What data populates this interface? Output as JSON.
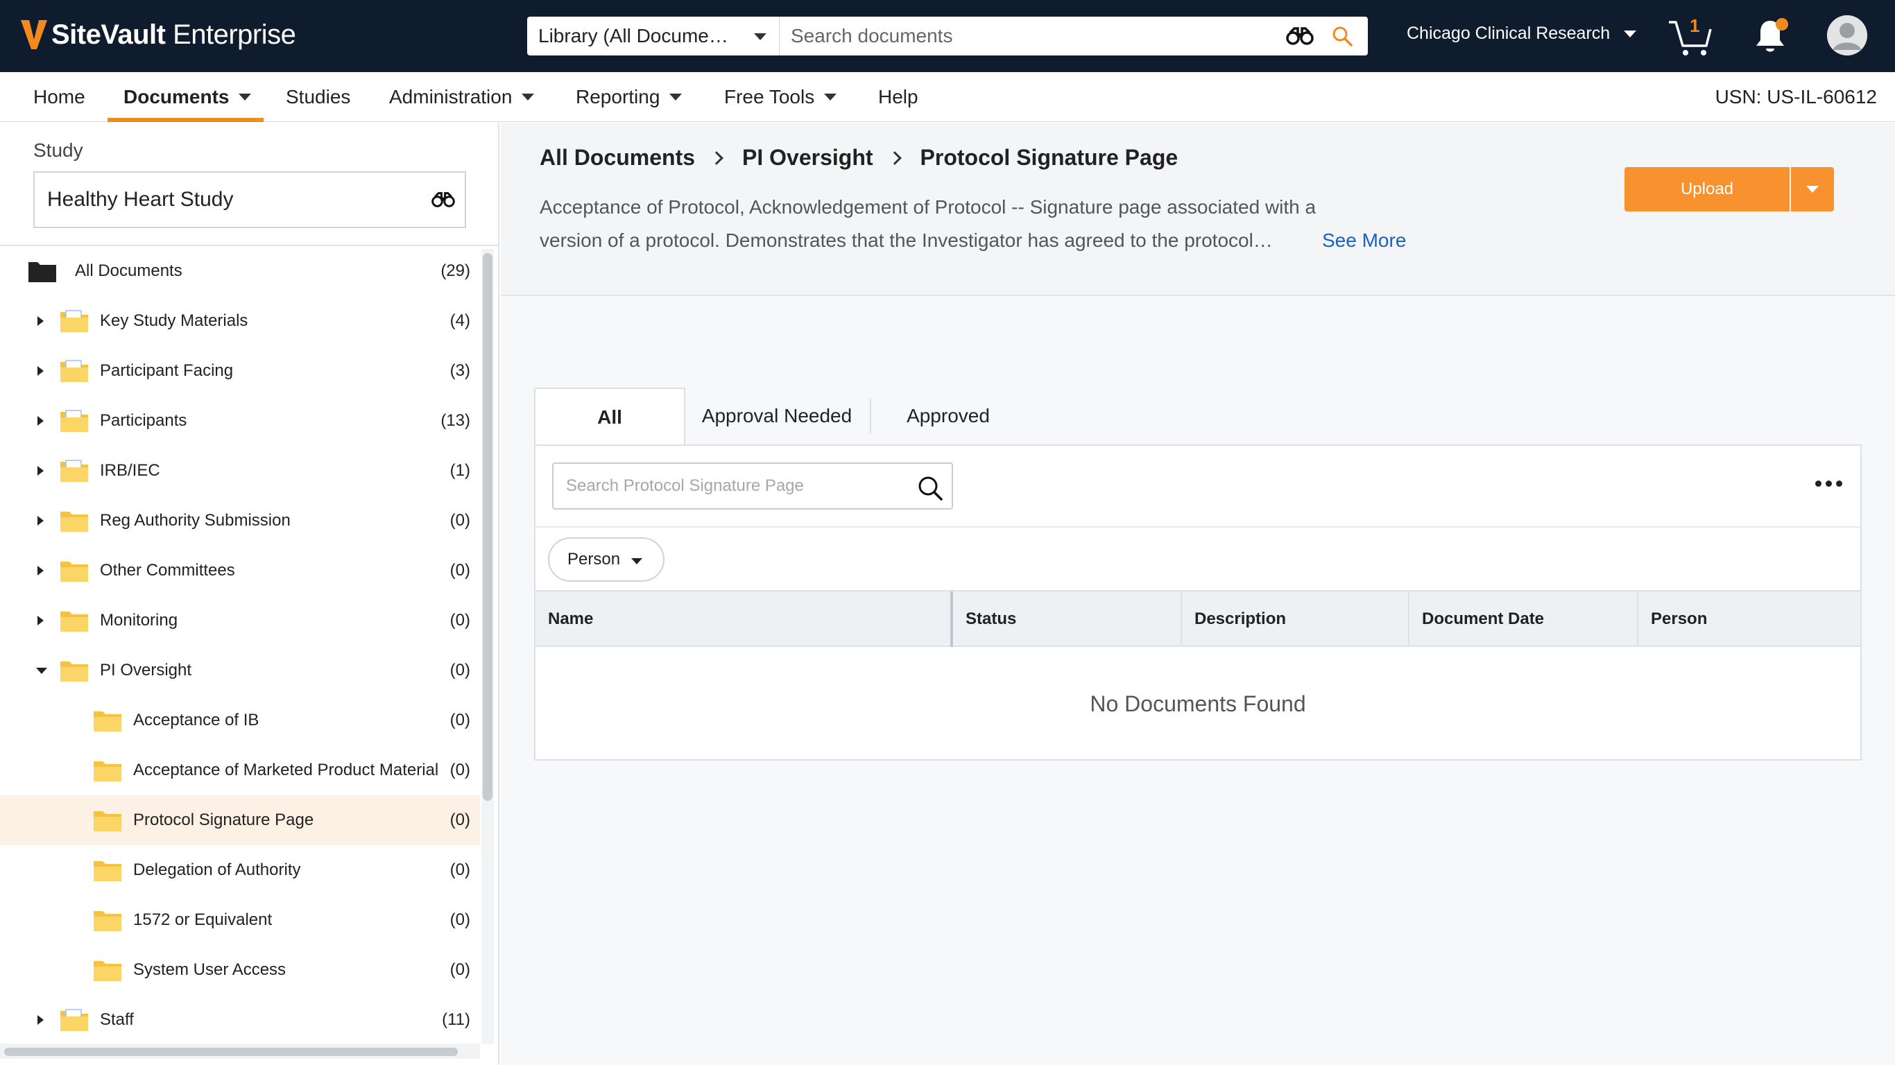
{
  "header": {
    "logo_text_bold": "SiteVault",
    "logo_text": " Enterprise",
    "scope_label": "Library (All Docume…",
    "search_placeholder": "Search documents",
    "org": "Chicago Clinical Research",
    "cart_count": "1",
    "accent": "#f28b1e"
  },
  "nav": {
    "items": [
      "Home",
      "Documents",
      "Studies",
      "Administration",
      "Reporting",
      "Free Tools",
      "Help"
    ],
    "usn": "USN: US-IL-60612"
  },
  "sidebar": {
    "study_label": "Study",
    "study_value": "Healthy Heart Study",
    "tree": [
      {
        "label": "All Documents",
        "count": "(29)",
        "expand": "none",
        "icon": "folder-dark-icon",
        "level": 0
      },
      {
        "label": "Key Study Materials",
        "count": "(4)",
        "expand": "collapsed",
        "icon": "folder-doc-icon",
        "level": 1
      },
      {
        "label": "Participant Facing",
        "count": "(3)",
        "expand": "collapsed",
        "icon": "folder-doc-icon",
        "level": 1
      },
      {
        "label": "Participants",
        "count": "(13)",
        "expand": "collapsed",
        "icon": "folder-doc-icon",
        "level": 1
      },
      {
        "label": "IRB/IEC",
        "count": "(1)",
        "expand": "collapsed",
        "icon": "folder-doc-icon",
        "level": 1
      },
      {
        "label": "Reg Authority Submission",
        "count": "(0)",
        "expand": "collapsed",
        "icon": "folder-icon",
        "level": 1
      },
      {
        "label": "Other Committees",
        "count": "(0)",
        "expand": "collapsed",
        "icon": "folder-icon",
        "level": 1
      },
      {
        "label": "Monitoring",
        "count": "(0)",
        "expand": "collapsed",
        "icon": "folder-icon",
        "level": 1
      },
      {
        "label": "PI Oversight",
        "count": "(0)",
        "expand": "expanded",
        "icon": "folder-icon",
        "level": 1
      },
      {
        "label": "Acceptance of IB",
        "count": "(0)",
        "expand": "none",
        "icon": "folder-icon",
        "level": 2
      },
      {
        "label": "Acceptance of Marketed Product Material",
        "count": "(0)",
        "expand": "none",
        "icon": "folder-icon",
        "level": 2
      },
      {
        "label": "Protocol Signature Page",
        "count": "(0)",
        "expand": "none",
        "icon": "folder-icon",
        "level": 2,
        "selected": true
      },
      {
        "label": "Delegation of Authority",
        "count": "(0)",
        "expand": "none",
        "icon": "folder-icon",
        "level": 2
      },
      {
        "label": "1572 or Equivalent",
        "count": "(0)",
        "expand": "none",
        "icon": "folder-icon",
        "level": 2
      },
      {
        "label": "System User Access",
        "count": "(0)",
        "expand": "none",
        "icon": "folder-icon",
        "level": 2
      },
      {
        "label": "Staff",
        "count": "(11)",
        "expand": "collapsed",
        "icon": "folder-doc-icon",
        "level": 1
      }
    ]
  },
  "main": {
    "breadcrumb": [
      "All Documents",
      "PI Oversight",
      "Protocol Signature Page"
    ],
    "description": "Acceptance of Protocol, Acknowledgement of Protocol -- Signature page associated with a version of a protocol. Demonstrates that the Investigator has agreed to the protocol…",
    "see_more": "See More",
    "upload_label": "Upload",
    "tabs": [
      "All",
      "Approval Needed",
      "Approved"
    ],
    "table_search_placeholder": "Search Protocol Signature Page",
    "filter_label": "Person",
    "columns": [
      "Name",
      "Status",
      "Description",
      "Document Date",
      "Person"
    ],
    "empty_text": "No Documents Found"
  }
}
